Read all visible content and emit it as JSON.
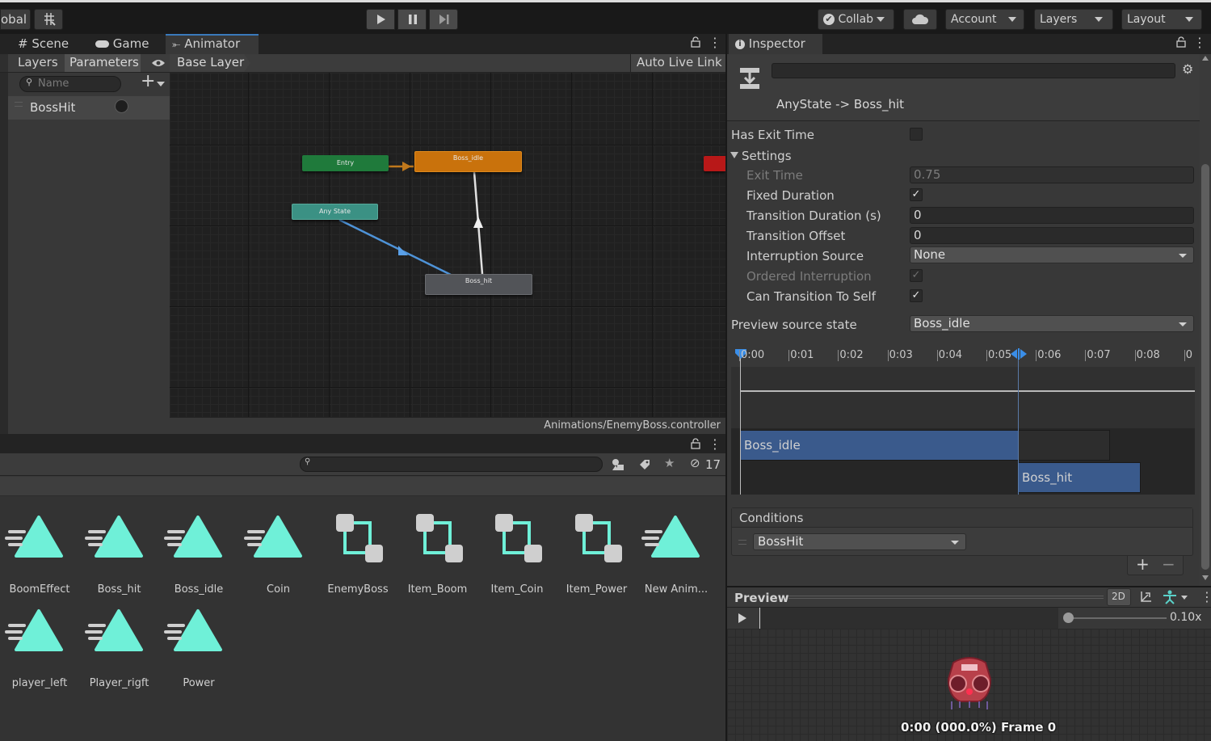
{
  "toolbar": {
    "global_label": "obal",
    "collab_label": "Collab",
    "account_label": "Account",
    "layers_label": "Layers",
    "layout_label": "Layout"
  },
  "scene_tabs": {
    "scene": "Scene",
    "game": "Game",
    "animator": "Animator"
  },
  "animator": {
    "layers_tab": "Layers",
    "parameters_tab": "Parameters",
    "base_layer": "Base Layer",
    "auto_live_link": "Auto Live Link",
    "search_placeholder": "Name",
    "parameters": [
      {
        "name": "BossHit"
      }
    ],
    "nodes": {
      "entry": "Entry",
      "boss_idle": "Boss_idle",
      "any_state": "Any State",
      "boss_hit": "Boss_hit"
    },
    "path": "Animations/EnemyBoss.controller"
  },
  "project": {
    "hidden_count": "17",
    "assets": [
      {
        "name": "BoomEffect",
        "type": "clip"
      },
      {
        "name": "Boss_hit",
        "type": "clip"
      },
      {
        "name": "Boss_idle",
        "type": "clip"
      },
      {
        "name": "Coin",
        "type": "clip"
      },
      {
        "name": "EnemyBoss",
        "type": "controller"
      },
      {
        "name": "Item_Boom",
        "type": "controller"
      },
      {
        "name": "Item_Coin",
        "type": "controller"
      },
      {
        "name": "Item_Power",
        "type": "controller"
      },
      {
        "name": "New Anim...",
        "type": "clip"
      },
      {
        "name": "player_left",
        "type": "clip"
      },
      {
        "name": "Player_rigft",
        "type": "clip"
      },
      {
        "name": "Power",
        "type": "clip"
      }
    ]
  },
  "inspector": {
    "tab": "Inspector",
    "transition": "AnyState -> Boss_hit",
    "has_exit_time": "Has Exit Time",
    "settings": "Settings",
    "exit_time_label": "Exit Time",
    "exit_time_value": "0.75",
    "fixed_duration": "Fixed Duration",
    "transition_duration_label": "Transition Duration (s)",
    "transition_duration_value": "0",
    "transition_offset_label": "Transition Offset",
    "transition_offset_value": "0",
    "interruption_source_label": "Interruption Source",
    "interruption_source_value": "None",
    "ordered_interruption": "Ordered Interruption",
    "can_transition_to_self": "Can Transition To Self",
    "preview_source_label": "Preview source state",
    "preview_source_value": "Boss_idle",
    "timeline_ticks": [
      "0:00",
      "0:01",
      "0:02",
      "0:03",
      "0:04",
      "0:05",
      "0:06",
      "0:07",
      "0:08",
      "0"
    ],
    "timeline_src": "Boss_idle",
    "timeline_dst": "Boss_hit",
    "conditions": "Conditions",
    "condition_param": "BossHit"
  },
  "preview": {
    "title": "Preview",
    "mode_2d": "2D",
    "speed": "0.10x",
    "frame_info": "0:00 (000.0%) Frame 0"
  },
  "colors": {
    "accent_blue": "#3a79bb",
    "clip_teal": "#6ff0d8",
    "entry_green": "#1e7a3a",
    "state_orange": "#c8700a",
    "any_state_teal": "#3a9184"
  }
}
